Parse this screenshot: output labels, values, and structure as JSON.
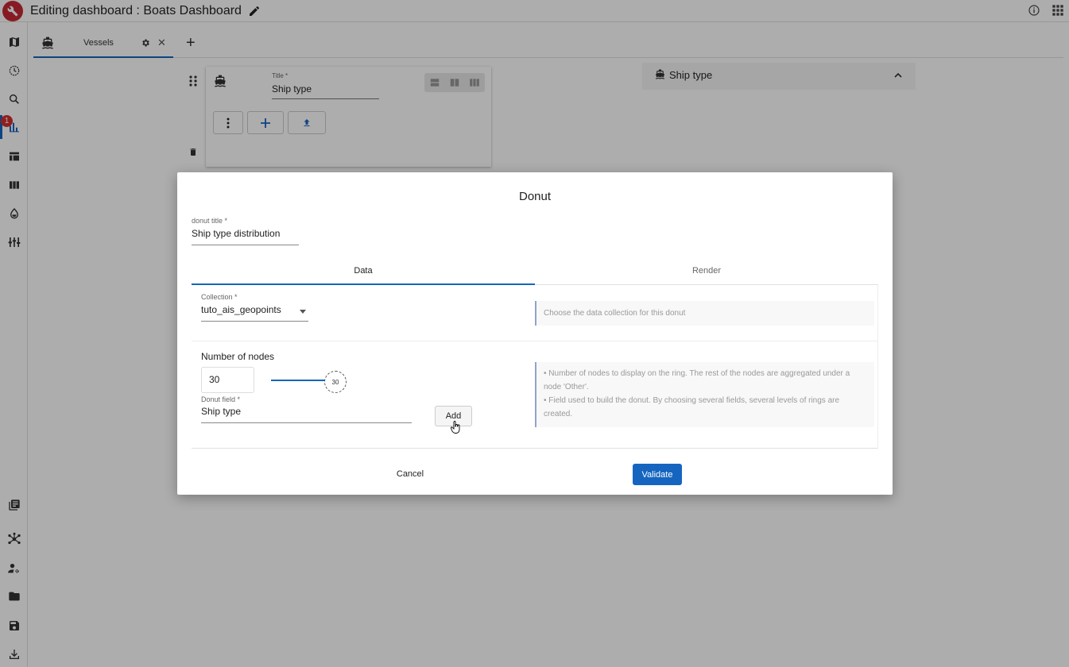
{
  "header": {
    "title": "Editing dashboard : Boats Dashboard"
  },
  "sidebar": {
    "badge_count": "1"
  },
  "tabs": [
    {
      "label": "Vessels"
    }
  ],
  "widget": {
    "title_label": "Title *",
    "title_value": "Ship type"
  },
  "preview": {
    "title": "Ship type"
  },
  "dialog": {
    "title": "Donut",
    "donut_title_label": "donut title *",
    "donut_title_value": "Ship type distribution",
    "tabs": [
      "Data",
      "Render"
    ],
    "collection_label": "Collection *",
    "collection_value": "tuto_ais_geopoints",
    "collection_hint": "Choose the data collection for this donut",
    "nodes_title": "Number of nodes",
    "nodes_value": "30",
    "slider_value": "30",
    "donut_field_label": "Donut field *",
    "donut_field_value": "Ship type",
    "add_label": "Add",
    "hint_nodes": "• Number of nodes to display on the ring. The rest of the nodes are aggregated under a node 'Other'.",
    "hint_field": "• Field used to build the donut. By choosing several fields, several levels of rings are created.",
    "cancel_label": "Cancel",
    "validate_label": "Validate"
  },
  "colors": {
    "accent": "#1565c0",
    "logo": "#c62834",
    "badge": "#d32f2f"
  }
}
